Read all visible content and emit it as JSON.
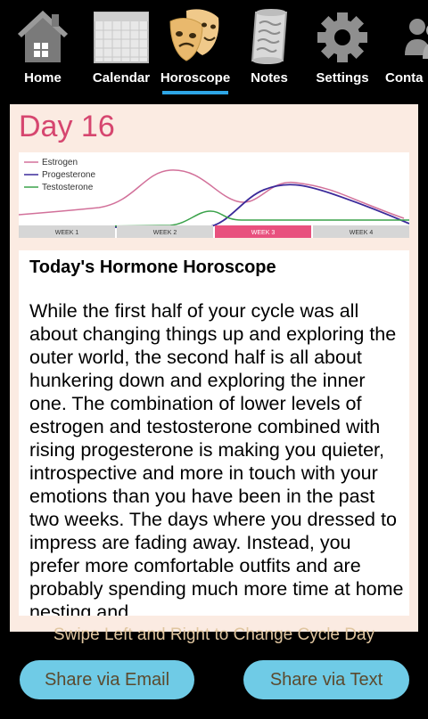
{
  "tabs": [
    {
      "label": "Home",
      "icon": "home-icon",
      "active": false
    },
    {
      "label": "Calendar",
      "icon": "calendar-icon",
      "active": false
    },
    {
      "label": "Horoscope",
      "icon": "theater-masks-icon",
      "active": true
    },
    {
      "label": "Notes",
      "icon": "scroll-icon",
      "active": false
    },
    {
      "label": "Settings",
      "icon": "gear-icon",
      "active": false
    },
    {
      "label": "Conta",
      "icon": "contacts-icon",
      "active": false
    }
  ],
  "day_title": "Day 16",
  "chart": {
    "legend": [
      "Estrogen",
      "Progesterone",
      "Testosterone"
    ],
    "colors": {
      "estrogen": "#d2719a",
      "progesterone": "#3b2a9a",
      "testosterone": "#3aa24a"
    },
    "weeks": [
      "WEEK 1",
      "WEEK 2",
      "WEEK 3",
      "WEEK 4"
    ],
    "active_week": "WEEK 3",
    "active_week_color": "#e8517e"
  },
  "horoscope": {
    "title": "Today's Hormone Horoscope",
    "body": "While the first half of your cycle was all about changing things up and exploring the outer world, the second half is all about hunkering down and exploring the inner one. The combination of lower levels of estrogen and testosterone combined with rising progesterone is making you quieter, introspective and more in touch with your emotions than you have been in the past two weeks. The days where you dressed to impress are fading away. Instead, you prefer more comfortable outfits and are probably spending much more time at home nesting and"
  },
  "swipe_hint": "Swipe Left and Right to Change Cycle Day",
  "buttons": {
    "email": "Share via Email",
    "text": "Share via Text"
  }
}
